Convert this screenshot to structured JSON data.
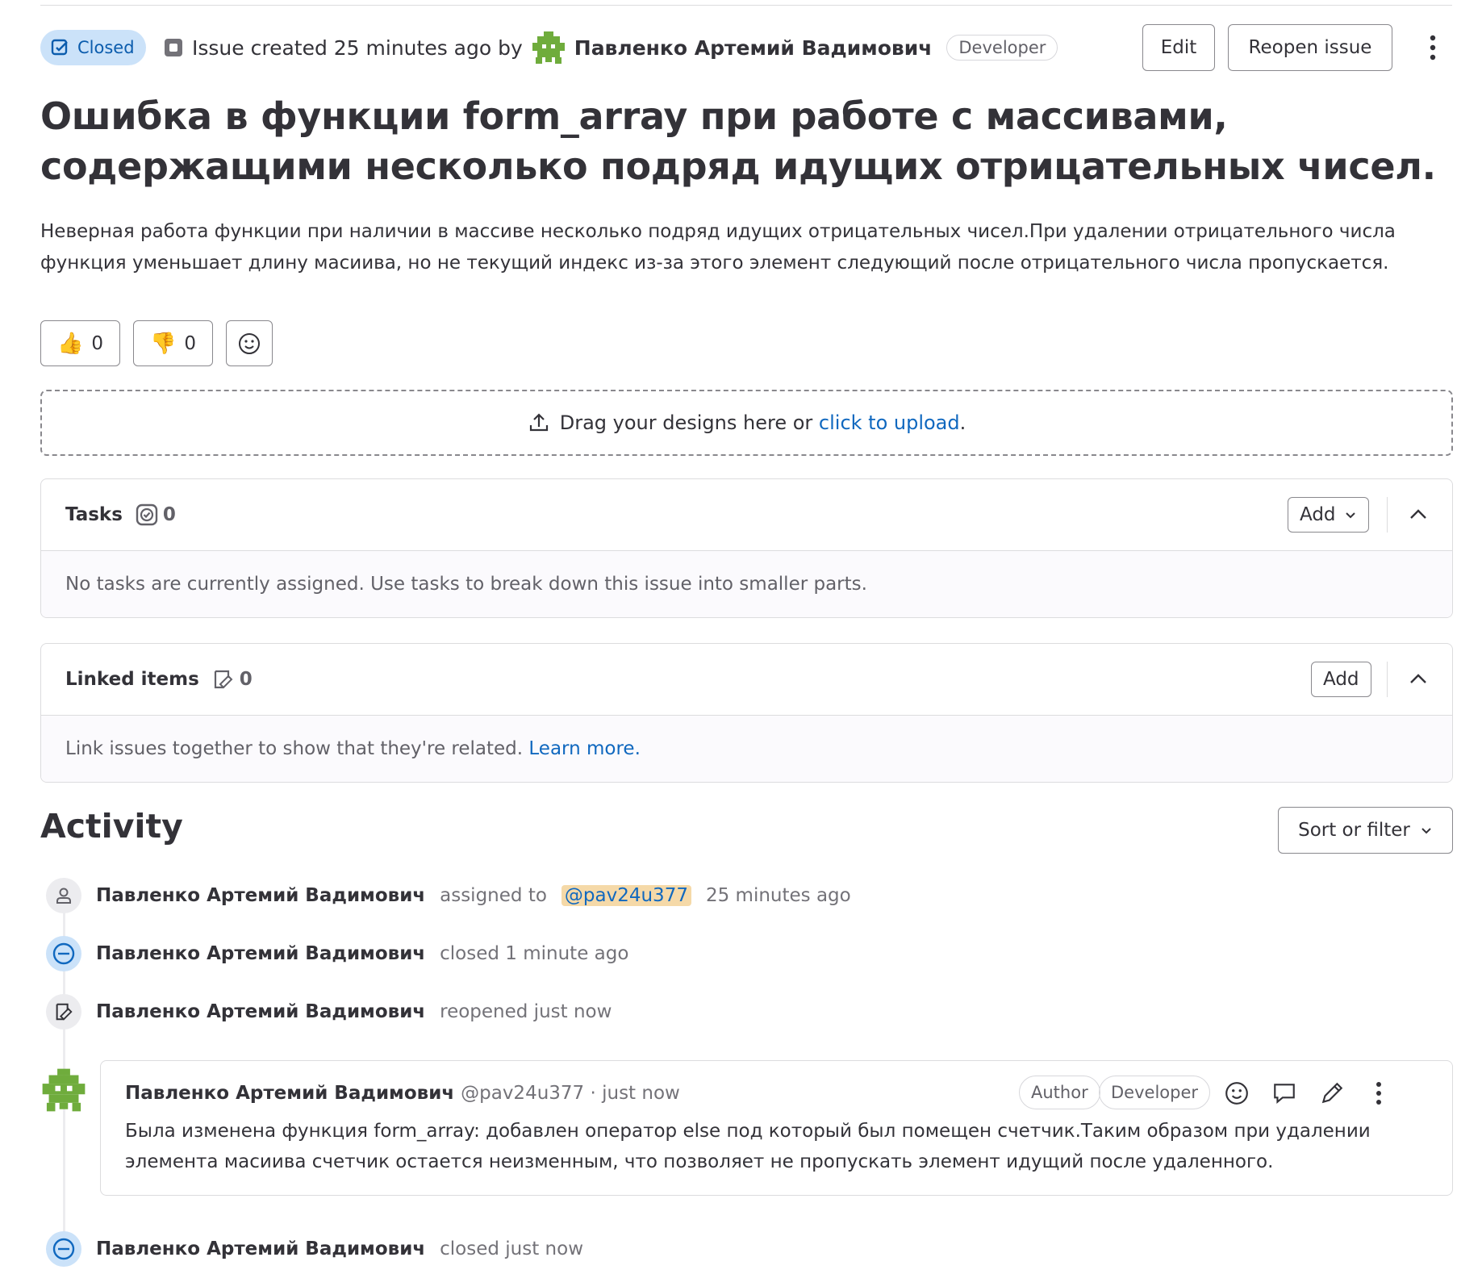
{
  "header": {
    "status": "Closed",
    "created_text": "Issue created 25 minutes ago by",
    "author": "Павленко Артемий Вадимович",
    "author_role": "Developer",
    "edit_label": "Edit",
    "reopen_label": "Reopen issue"
  },
  "issue": {
    "title": "Ошибка в функции form_array при работе с массивами, содержащими несколько подряд идущих отрицательных чисел.",
    "description": "Неверная работа функции при наличии в массиве несколько подряд идущих отрицательных чисел.При удалении отрицательного числа функция уменьшает длину масиива, но не текущий индекс из-за этого элемент следующий после отрицательного числа пропускается."
  },
  "reactions": {
    "thumbs_up_count": "0",
    "thumbs_down_count": "0"
  },
  "upload": {
    "text": "Drag your designs here or",
    "link": "click to upload",
    "suffix": "."
  },
  "tasks": {
    "title": "Tasks",
    "count": "0",
    "add_label": "Add",
    "empty_text": "No tasks are currently assigned. Use tasks to break down this issue into smaller parts."
  },
  "linked": {
    "title": "Linked items",
    "count": "0",
    "add_label": "Add",
    "empty_text": "Link issues together to show that they're related.",
    "learn_more": "Learn more."
  },
  "activity": {
    "title": "Activity",
    "sort_label": "Sort or filter",
    "events": [
      {
        "name": "Павленко Артемий Вадимович",
        "action": "assigned to",
        "mention": "@pav24u377",
        "time": "25 minutes ago"
      },
      {
        "name": "Павленко Артемий Вадимович",
        "action": "closed 1 minute ago"
      },
      {
        "name": "Павленко Артемий Вадимович",
        "action": "reopened just now"
      },
      {
        "name": "Павленко Артемий Вадимович",
        "action": "closed just now"
      }
    ],
    "note": {
      "name": "Павленко Артемий Вадимович",
      "handle": "@pav24u377 · just now",
      "author_badge": "Author",
      "role_badge": "Developer",
      "body": "Была изменена функция form_array: добавлен оператор else под который был помещен счетчик.Таким образом при удалении элемента масиива счетчик остается неизменным, что позволяет не пропускать элемент идущий после удаленного."
    }
  },
  "colors": {
    "accent": "#1068bf",
    "closed_badge_bg": "#cbe2f9",
    "avatar_green": "#6fac3c"
  }
}
